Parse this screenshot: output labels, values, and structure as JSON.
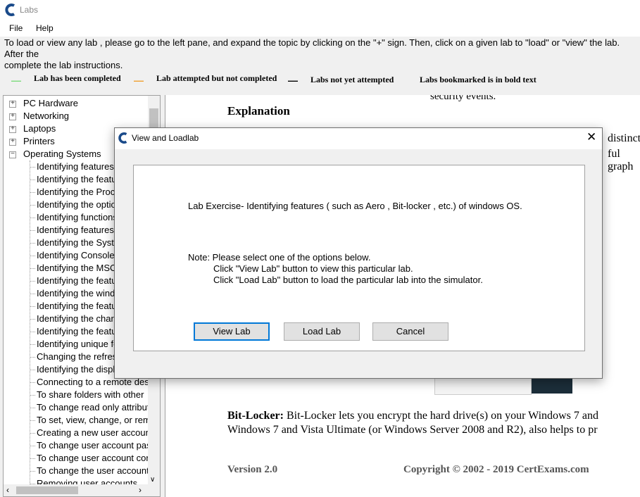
{
  "window": {
    "title": "Labs",
    "brand_color": "#1a4a8a"
  },
  "menu": [
    "File",
    "Help"
  ],
  "instructions": "To load or view any lab , please go to the left pane, and expand the topic by clicking on the \"+\" sign. Then, click on a given lab to \"load\" or \"view\" the lab.  After the\ncomplete the lab instructions.",
  "legend": [
    {
      "dash": "—",
      "color": "#7ddb7d",
      "label": "Lab has been completed"
    },
    {
      "dash": "—",
      "color": "#f0a030",
      "label": "Lab attempted but not completed"
    },
    {
      "dash": "—",
      "color": "#000000",
      "label": "Labs not yet  attempted"
    },
    {
      "dash": "",
      "color": "#000000",
      "label": "Labs bookmarked is in bold text"
    }
  ],
  "tree": {
    "categories": [
      {
        "label": "PC Hardware",
        "expander": "+"
      },
      {
        "label": "Networking",
        "expander": "+"
      },
      {
        "label": "Laptops",
        "expander": "+"
      },
      {
        "label": "Printers",
        "expander": "+"
      },
      {
        "label": "Operating Systems",
        "expander": "−"
      }
    ],
    "labs": [
      "Identifying features (such as Aero",
      "Identifying the features",
      "Identifying the Process",
      "Identifying the options",
      "Identifying  functions",
      "Identifying features of",
      "Identifying the System",
      "Identifying Console",
      "Identifying the MSCONFIG",
      "Identifying the features",
      "Identifying the windows",
      "Identifying the features",
      "Identifying the charm",
      "Identifying the features",
      "Identifying unique features",
      "Changing the refresh",
      "Identifying the display",
      "Connecting to a remote desktop",
      "To share folders with other",
      "To change read only attributes",
      "To set, view, change, or remove",
      "Creating a new user account",
      "To change user account password",
      "To change user account control",
      "To change the user account",
      "Removing user accounts"
    ]
  },
  "content": {
    "top_fragment": "security  events.",
    "heading": "Explanation",
    "right_fragment_1": "distinctive",
    "right_fragment_2": "ful graph",
    "bitlocker_label": "Bit-Locker:",
    "bitlocker_text": " Bit-Locker lets you encrypt the hard drive(s) on your Windows 7 and",
    "bitlocker_text_2": "Windows 7 and Vista Ultimate (or Windows Server 2008 and R2), also helps to pr",
    "version": "Version 2.0",
    "copyright": "Copyright © 2002 - 2019 CertExams.com"
  },
  "dialog": {
    "title": "View and Loadlab",
    "close": "✕",
    "exercise": "Lab Exercise- Identifying features ( such as Aero , Bit-locker , etc.) of windows OS.",
    "note_1": "Note:  Please select one of the options below.",
    "note_2": "Click  \"View Lab\"  button to view this particular lab.",
    "note_3": "Click  \"Load Lab\"  button to load the particular lab into the simulator.",
    "buttons": {
      "view": "View Lab",
      "load": "Load Lab",
      "cancel": "Cancel"
    }
  }
}
